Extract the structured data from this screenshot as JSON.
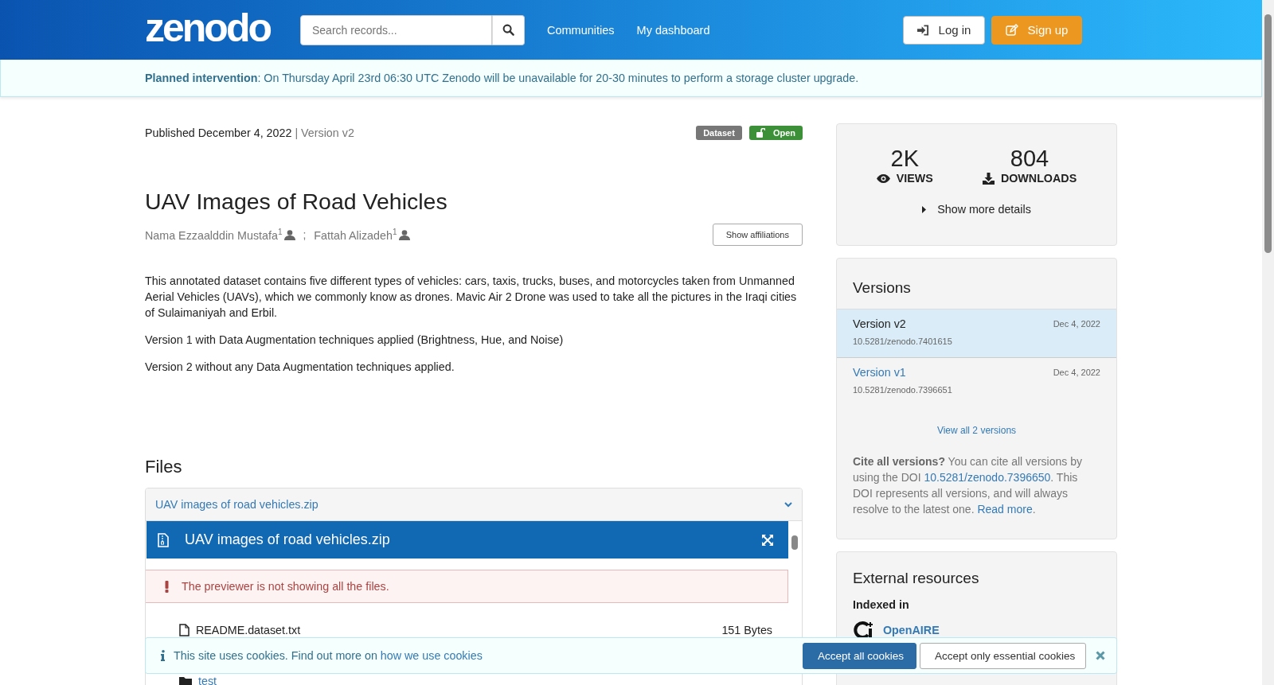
{
  "header": {
    "logo": "zenodo",
    "search": {
      "placeholder": "Search records..."
    },
    "nav": [
      "Communities",
      "My dashboard"
    ],
    "buttons": [
      {
        "label": "Log in",
        "kind": "login"
      },
      {
        "label": "Sign up",
        "kind": "signup"
      }
    ]
  },
  "banner": {
    "text": "**Planned intervention**: On Thursday April 23rd 06:30 UTC Zenodo will be unavailable for 20-30 minutes to perform a storage cluster upgrade."
  },
  "record": {
    "published": "Published December 4, 2022",
    "version": "| Version v2",
    "badges": [
      {
        "label": "Dataset",
        "kind": "type"
      },
      {
        "label": "Open",
        "kind": "access"
      }
    ],
    "title": "UAV Images of Road Vehicles",
    "authors": [
      {
        "name": "Nama Ezzaalddin Mustafa$^{1}$"
      },
      {
        "name": "Fattah Alizadeh$^{1}$"
      }
    ],
    "separator": ";",
    "show_affiliations": "Show affiliations",
    "description": [
      "This annotated dataset contains five different types of vehicles: cars, taxis, trucks, buses, and motorcycles taken from Unmanned Aerial Vehicles (UAVs), which we commonly know as drones. Mavic Air 2 Drone was used to take all the pictures in the Iraqi cities of Sulaimaniyah and Erbil.",
      "Version 1 with Data Augmentation techniques applied (Brightness, Hue, and Noise)",
      "Version 2 without any Data Augmentation techniques applied."
    ]
  },
  "files": {
    "heading": "Files",
    "panel_title": "UAV images of road vehicles.zip",
    "expanded": true,
    "preview": {
      "title": "UAV images of road vehicles.zip",
      "alert": "The previewer is not showing all the files.",
      "entries": [
        {
          "kind": "file",
          "name": "README.dataset.txt",
          "size": "151 Bytes"
        },
        {
          "kind": "folder",
          "name": "test"
        }
      ]
    }
  },
  "sidebar": {
    "stats": [
      {
        "value": "2K",
        "label": "VIEWS",
        "kind": "views"
      },
      {
        "value": "804",
        "label": "DOWNLOADS",
        "kind": "downloads"
      }
    ],
    "show_more": "Show more details",
    "versions": {
      "heading": "Versions",
      "items": [
        {
          "label": "Version v2",
          "date": "Dec 4, 2022",
          "doi": "10.5281/zenodo.7401615",
          "selected": true
        },
        {
          "label": "Version v1",
          "date": "Dec 4, 2022",
          "doi": "10.5281/zenodo.7396651",
          "selected": false
        }
      ],
      "view_all": "View all 2 versions",
      "cite": [
        {
          "kind": "bold",
          "text": "Cite all versions?"
        },
        {
          "kind": "text",
          "text": " You can cite all versions by using the DOI "
        },
        {
          "kind": "link",
          "text": "10.5281/zenodo.7396650"
        },
        {
          "kind": "text",
          "text": ". This DOI represents all versions, and will always resolve to the latest one. "
        },
        {
          "kind": "link",
          "text": "Read more"
        },
        {
          "kind": "text",
          "text": "."
        }
      ]
    },
    "external": {
      "heading": "External resources",
      "subheading": "Indexed in",
      "items": [
        {
          "name": "OpenAIRE"
        }
      ]
    }
  },
  "cookie_bar": {
    "text": "This site uses cookies. Find out more on ",
    "link": "how we use cookies",
    "buttons": [
      {
        "label": "Accept all cookies",
        "kind": "primary"
      },
      {
        "label": "Accept only essential cookies",
        "kind": "default"
      }
    ]
  }
}
